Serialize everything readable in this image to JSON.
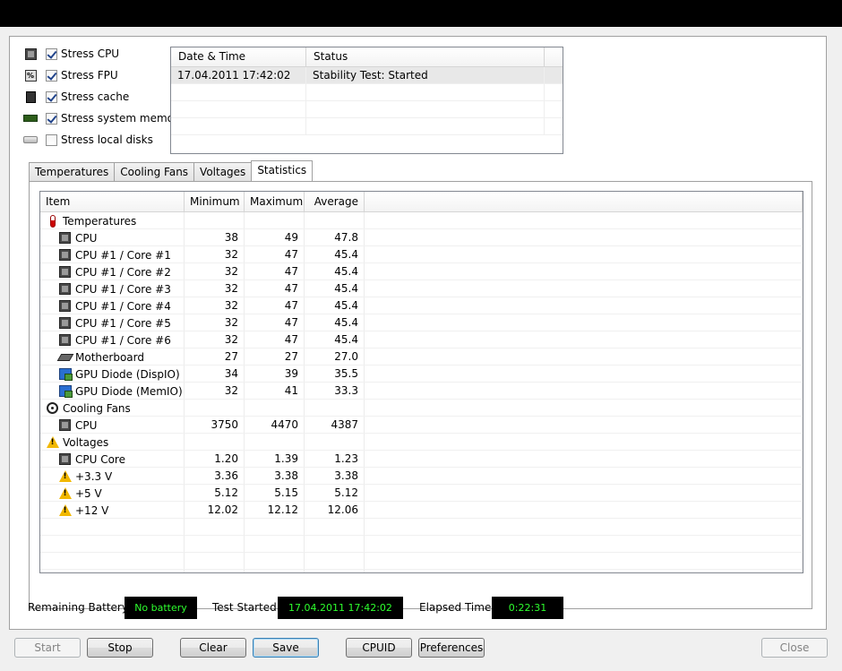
{
  "stress_options": [
    {
      "label": "Stress CPU",
      "checked": true,
      "icon": "cpu-icon"
    },
    {
      "label": "Stress FPU",
      "checked": true,
      "icon": "fpu-icon"
    },
    {
      "label": "Stress cache",
      "checked": true,
      "icon": "cache-icon"
    },
    {
      "label": "Stress system memory",
      "checked": true,
      "icon": "memory-icon"
    },
    {
      "label": "Stress local disks",
      "checked": false,
      "icon": "disk-icon"
    }
  ],
  "log": {
    "headers": [
      "Date & Time",
      "Status"
    ],
    "rows": [
      {
        "datetime": "17.04.2011 17:42:02",
        "status": "Stability Test: Started"
      }
    ]
  },
  "tabs": [
    "Temperatures",
    "Cooling Fans",
    "Voltages",
    "Statistics"
  ],
  "active_tab": "Statistics",
  "stats": {
    "headers": {
      "item": "Item",
      "min": "Minimum",
      "max": "Maximum",
      "avg": "Average"
    },
    "rows": [
      {
        "type": "group",
        "label": "Temperatures",
        "icon": "thermometer-icon"
      },
      {
        "type": "item",
        "label": "CPU",
        "icon": "cpu-icon",
        "min": "38",
        "max": "49",
        "avg": "47.8"
      },
      {
        "type": "item",
        "label": "CPU #1 / Core #1",
        "icon": "cpu-icon",
        "min": "32",
        "max": "47",
        "avg": "45.4"
      },
      {
        "type": "item",
        "label": "CPU #1 / Core #2",
        "icon": "cpu-icon",
        "min": "32",
        "max": "47",
        "avg": "45.4"
      },
      {
        "type": "item",
        "label": "CPU #1 / Core #3",
        "icon": "cpu-icon",
        "min": "32",
        "max": "47",
        "avg": "45.4"
      },
      {
        "type": "item",
        "label": "CPU #1 / Core #4",
        "icon": "cpu-icon",
        "min": "32",
        "max": "47",
        "avg": "45.4"
      },
      {
        "type": "item",
        "label": "CPU #1 / Core #5",
        "icon": "cpu-icon",
        "min": "32",
        "max": "47",
        "avg": "45.4"
      },
      {
        "type": "item",
        "label": "CPU #1 / Core #6",
        "icon": "cpu-icon",
        "min": "32",
        "max": "47",
        "avg": "45.4"
      },
      {
        "type": "item",
        "label": "Motherboard",
        "icon": "motherboard-icon",
        "min": "27",
        "max": "27",
        "avg": "27.0"
      },
      {
        "type": "item",
        "label": "GPU Diode (DispIO)",
        "icon": "gpu-icon",
        "min": "34",
        "max": "39",
        "avg": "35.5"
      },
      {
        "type": "item",
        "label": "GPU Diode (MemIO)",
        "icon": "gpu-icon",
        "min": "32",
        "max": "41",
        "avg": "33.3"
      },
      {
        "type": "group",
        "label": "Cooling Fans",
        "icon": "fan-icon"
      },
      {
        "type": "item",
        "label": "CPU",
        "icon": "cpu-icon",
        "min": "3750",
        "max": "4470",
        "avg": "4387"
      },
      {
        "type": "group",
        "label": "Voltages",
        "icon": "warning-icon"
      },
      {
        "type": "item",
        "label": "CPU Core",
        "icon": "cpu-icon",
        "min": "1.20",
        "max": "1.39",
        "avg": "1.23"
      },
      {
        "type": "item",
        "label": "+3.3 V",
        "icon": "warning-icon",
        "min": "3.36",
        "max": "3.38",
        "avg": "3.38"
      },
      {
        "type": "item",
        "label": "+5 V",
        "icon": "warning-icon",
        "min": "5.12",
        "max": "5.15",
        "avg": "5.12"
      },
      {
        "type": "item",
        "label": "+12 V",
        "icon": "warning-icon",
        "min": "12.02",
        "max": "12.12",
        "avg": "12.06"
      }
    ],
    "empty_rows": 4
  },
  "status": {
    "battery_label": "Remaining Battery:",
    "battery_value": "No battery",
    "started_label": "Test Started:",
    "started_value": "17.04.2011 17:42:02",
    "elapsed_label": "Elapsed Time:",
    "elapsed_value": "0:22:31"
  },
  "buttons": {
    "start": "Start",
    "stop": "Stop",
    "clear": "Clear",
    "save": "Save",
    "cpuid": "CPUID",
    "preferences": "Preferences",
    "close": "Close"
  },
  "colors": {
    "lcd_text": "#2eff2e",
    "lcd_bg": "#000000"
  }
}
